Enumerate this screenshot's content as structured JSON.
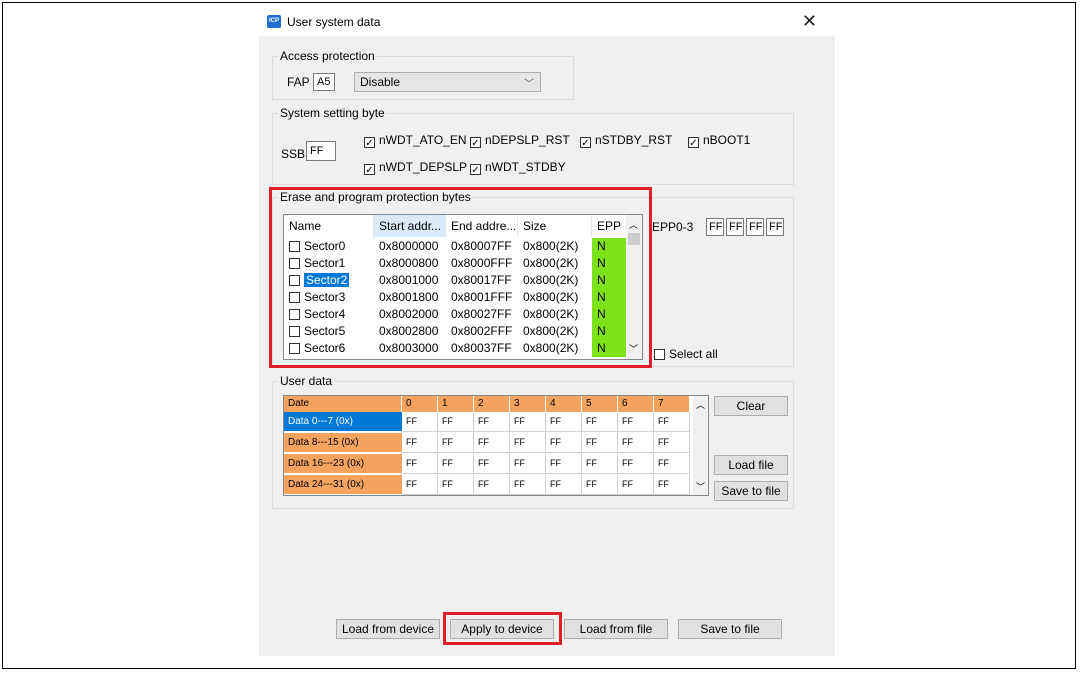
{
  "window": {
    "title": "User system data",
    "app_icon": "ICP"
  },
  "access_protection": {
    "legend": "Access protection",
    "fap_label": "FAP",
    "fap_value": "A5",
    "mode": "Disable"
  },
  "system_setting": {
    "legend": "System setting byte",
    "ssb_label": "SSB",
    "ssb_value": "FF",
    "options": [
      "nWDT_ATO_EN",
      "nDEPSLP_RST",
      "nSTDBY_RST",
      "nBOOT1",
      "nWDT_DEPSLP",
      "nWDT_STDBY"
    ]
  },
  "epp": {
    "legend": "Erase and program protection bytes",
    "columns": [
      "Name",
      "Start addr...",
      "End addre...",
      "Size",
      "EPP"
    ],
    "rows": [
      {
        "name": "Sector0",
        "start": "0x8000000",
        "end": "0x80007FF",
        "size": "0x800(2K)",
        "epp": "N"
      },
      {
        "name": "Sector1",
        "start": "0x8000800",
        "end": "0x8000FFF",
        "size": "0x800(2K)",
        "epp": "N"
      },
      {
        "name": "Sector2",
        "start": "0x8001000",
        "end": "0x80017FF",
        "size": "0x800(2K)",
        "epp": "N"
      },
      {
        "name": "Sector3",
        "start": "0x8001800",
        "end": "0x8001FFF",
        "size": "0x800(2K)",
        "epp": "N"
      },
      {
        "name": "Sector4",
        "start": "0x8002000",
        "end": "0x80027FF",
        "size": "0x800(2K)",
        "epp": "N"
      },
      {
        "name": "Sector5",
        "start": "0x8002800",
        "end": "0x8002FFF",
        "size": "0x800(2K)",
        "epp": "N"
      },
      {
        "name": "Sector6",
        "start": "0x8003000",
        "end": "0x80037FF",
        "size": "0x800(2K)",
        "epp": "N"
      }
    ],
    "epp_label": "EPP0-3",
    "epp_values": [
      "FF",
      "FF",
      "FF",
      "FF"
    ],
    "select_all": "Select all",
    "epp_color": "#7ee21b"
  },
  "user_data": {
    "legend": "User data",
    "header": [
      "Date",
      "0",
      "1",
      "2",
      "3",
      "4",
      "5",
      "6",
      "7"
    ],
    "rows": [
      {
        "label": "Data 0---7 (0x)",
        "cells": [
          "FF",
          "FF",
          "FF",
          "FF",
          "FF",
          "FF",
          "FF",
          "FF"
        ]
      },
      {
        "label": "Data 8---15 (0x)",
        "cells": [
          "FF",
          "FF",
          "FF",
          "FF",
          "FF",
          "FF",
          "FF",
          "FF"
        ]
      },
      {
        "label": "Data 16---23 (0x)",
        "cells": [
          "FF",
          "FF",
          "FF",
          "FF",
          "FF",
          "FF",
          "FF",
          "FF"
        ]
      },
      {
        "label": "Data 24---31 (0x)",
        "cells": [
          "FF",
          "FF",
          "FF",
          "FF",
          "FF",
          "FF",
          "FF",
          "FF"
        ]
      }
    ],
    "clear": "Clear",
    "load_file": "Load file",
    "save_to_file": "Save to file",
    "header_color": "#f5a35f"
  },
  "footer": {
    "load_from_device": "Load from device",
    "apply_to_device": "Apply to device",
    "load_from_file": "Load from file",
    "save_to_file": "Save to file"
  },
  "highlight_color": "#e01e25"
}
